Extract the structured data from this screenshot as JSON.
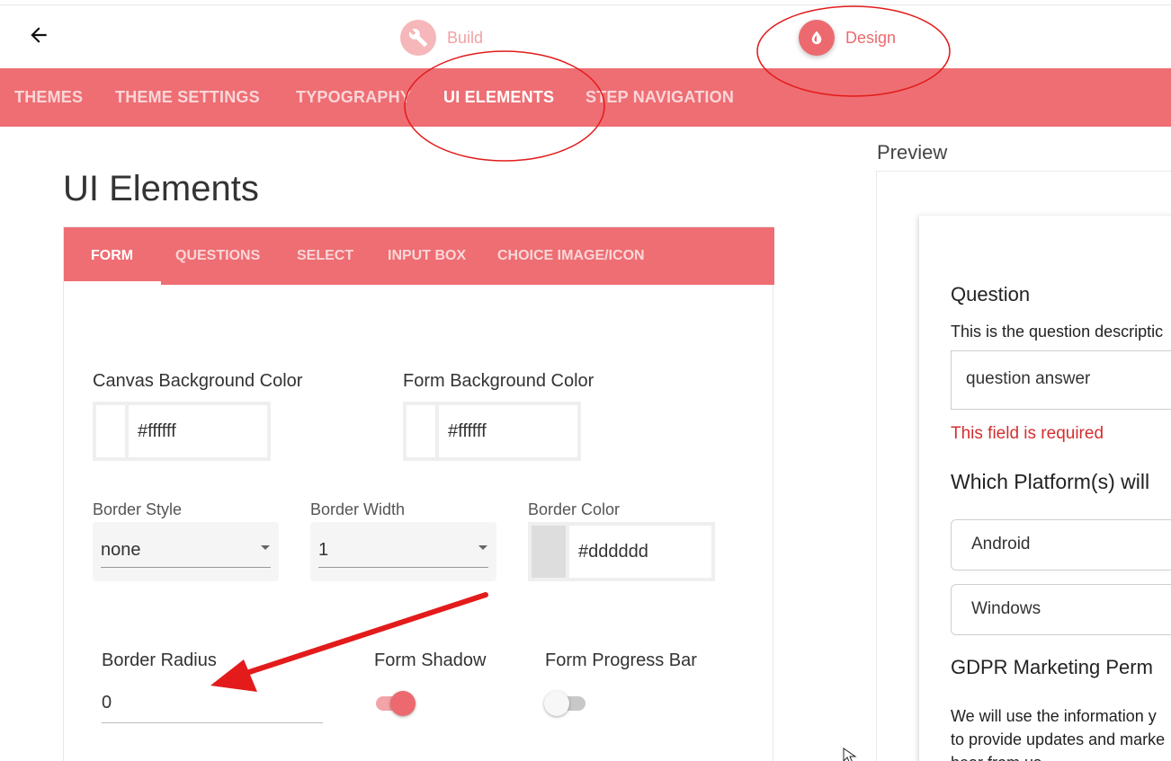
{
  "colors": {
    "accent": "#ee6e73",
    "accent_dark": "#ec6a6f",
    "annotation": "#e31b1b",
    "error": "#d32f2f"
  },
  "header": {
    "back_icon": "arrow-left-icon",
    "modes": [
      {
        "label": "Build",
        "icon": "wrench-icon"
      },
      {
        "label": "Design",
        "icon": "drop-icon"
      }
    ]
  },
  "nav": {
    "tabs": [
      {
        "label": "THEMES"
      },
      {
        "label": "THEME SETTINGS"
      },
      {
        "label": "TYPOGRAPHY"
      },
      {
        "label": "UI ELEMENTS"
      },
      {
        "label": "STEP NAVIGATION"
      }
    ],
    "active": "UI ELEMENTS"
  },
  "page": {
    "title": "UI Elements"
  },
  "subtabs": {
    "tabs": [
      {
        "label": "FORM"
      },
      {
        "label": "QUESTIONS"
      },
      {
        "label": "SELECT"
      },
      {
        "label": "INPUT BOX"
      },
      {
        "label": "CHOICE IMAGE/ICON"
      }
    ],
    "active": "FORM"
  },
  "form": {
    "canvas_bg": {
      "label": "Canvas Background Color",
      "value": "#ffffff"
    },
    "form_bg": {
      "label": "Form Background Color",
      "value": "#ffffff"
    },
    "border_style": {
      "label": "Border Style",
      "value": "none"
    },
    "border_width": {
      "label": "Border Width",
      "value": "1"
    },
    "border_color": {
      "label": "Border Color",
      "value": "#dddddd"
    },
    "border_radius": {
      "label": "Border Radius",
      "value": "0"
    },
    "form_shadow": {
      "label": "Form Shadow",
      "on": true
    },
    "progress_bar": {
      "label": "Form Progress Bar",
      "on": false
    }
  },
  "preview": {
    "label": "Preview",
    "question": "Question",
    "description": "This is the question descriptic",
    "answer": "question answer",
    "error": "This field is required",
    "question2": "Which Platform(s) will",
    "options": [
      "Android",
      "Windows"
    ],
    "gdpr_title": "GDPR Marketing Perm",
    "gdpr_lines": [
      "We will use the information y",
      "to provide updates and marke",
      "hear from us"
    ]
  }
}
